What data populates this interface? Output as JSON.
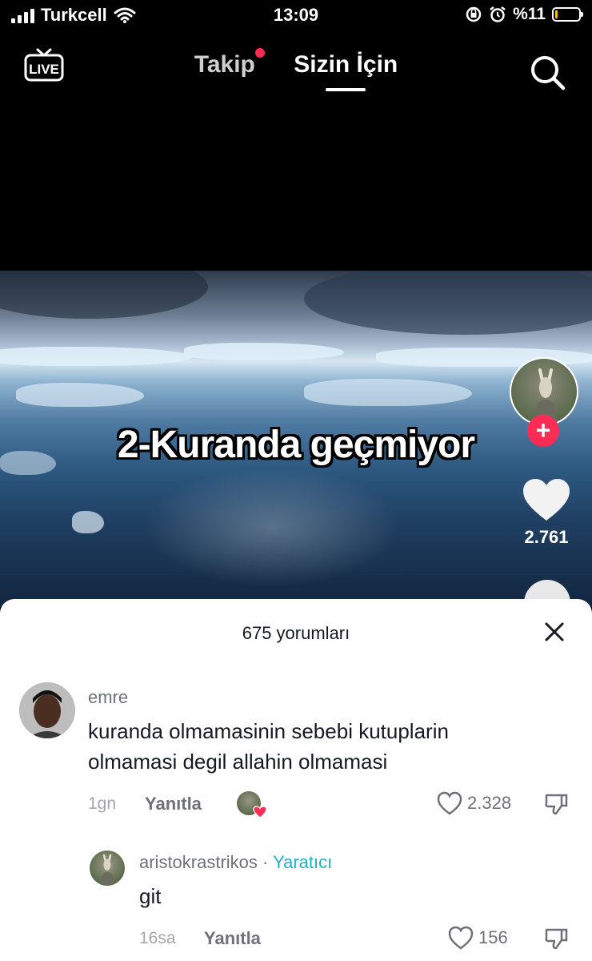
{
  "status_bar": {
    "carrier": "Turkcell",
    "time": "13:09",
    "battery": "%11",
    "battery_level": 0.11
  },
  "top_nav": {
    "live_label": "LIVE",
    "tabs": [
      {
        "label": "Takip",
        "active": false,
        "has_notification_dot": true
      },
      {
        "label": "Sizin İçin",
        "active": true
      }
    ]
  },
  "video": {
    "caption": "2-Kuranda geçmiyor",
    "follow_symbol": "+",
    "like_count": "2.761"
  },
  "comments_sheet": {
    "title": "675 yorumları",
    "comments": [
      {
        "username": "emre",
        "text": "kuranda olmamasinin sebebi kutuplarin olmamasi degil allahin olmamasi",
        "time": "1gn",
        "reply_label": "Yanıtla",
        "likes": "2.328",
        "liked_by_creator": true
      }
    ],
    "replies": [
      {
        "username": "aristokrastrikos",
        "separator": " · ",
        "badge": "Yaratıcı",
        "text": "git",
        "time": "16sa",
        "reply_label": "Yanıtla",
        "likes": "156"
      }
    ]
  },
  "colors": {
    "accent_red": "#fe2c55",
    "creator_badge": "#20b0c8"
  },
  "icons": [
    "signal-icon",
    "wifi-icon",
    "rotation-lock-icon",
    "alarm-icon",
    "battery-icon",
    "live-tv-icon",
    "search-icon",
    "heart-icon",
    "close-icon",
    "thumbs-down-icon"
  ]
}
